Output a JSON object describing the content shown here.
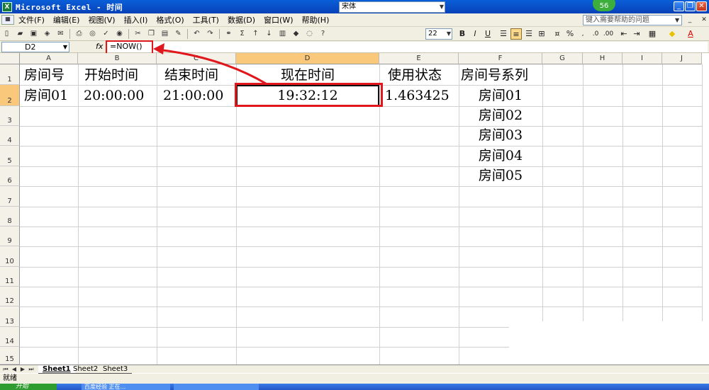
{
  "window": {
    "title": "Microsoft Excel - 时间",
    "badge": "56",
    "buttons": {
      "minimize": "_",
      "restore": "❐",
      "close": "✕"
    }
  },
  "menu": {
    "items": [
      "文件(F)",
      "编辑(E)",
      "视图(V)",
      "插入(I)",
      "格式(O)",
      "工具(T)",
      "数据(D)",
      "窗口(W)",
      "帮助(H)"
    ],
    "help_placeholder": "键入需要帮助的问题"
  },
  "toolbar": {
    "font_name": "宋体",
    "font_size": "22",
    "bold": "B",
    "italic": "I",
    "underline": "U",
    "percent": "%",
    "sigma": "Σ"
  },
  "formula_bar": {
    "name_box": "D2",
    "fx": "fx",
    "formula": "=NOW()"
  },
  "sheet": {
    "columns": [
      "A",
      "B",
      "C",
      "D",
      "E",
      "F",
      "G",
      "H",
      "I",
      "J"
    ],
    "selected_column": "D",
    "rows": [
      "1",
      "2",
      "3",
      "4",
      "5",
      "6",
      "7",
      "8",
      "9",
      "10",
      "11",
      "12",
      "13",
      "14",
      "15"
    ],
    "selected_row": "2",
    "cells": {
      "A1": "房间号",
      "B1": "开始时间",
      "C1": "结束时间",
      "D1": "现在时间",
      "E1": "使用状态",
      "F1": "房间号系列",
      "A2": "房间01",
      "B2": "20:00:00",
      "C2": "21:00:00",
      "D2": "19:32:12",
      "E2": "1.463425",
      "F2": "房间01",
      "F3": "房间02",
      "F4": "房间03",
      "F5": "房间04",
      "F6": "房间05"
    }
  },
  "tabs": [
    "Sheet1",
    "Sheet2",
    "Sheet3"
  ],
  "active_tab": "Sheet1",
  "status": "就绪",
  "taskbar": {
    "start": "开始",
    "items": [
      "百度经验 正在...",
      ""
    ]
  },
  "colors": {
    "annotation_red": "#e0171c",
    "selected_header": "#f9c87a",
    "title_blue": "#0a5fd8"
  }
}
